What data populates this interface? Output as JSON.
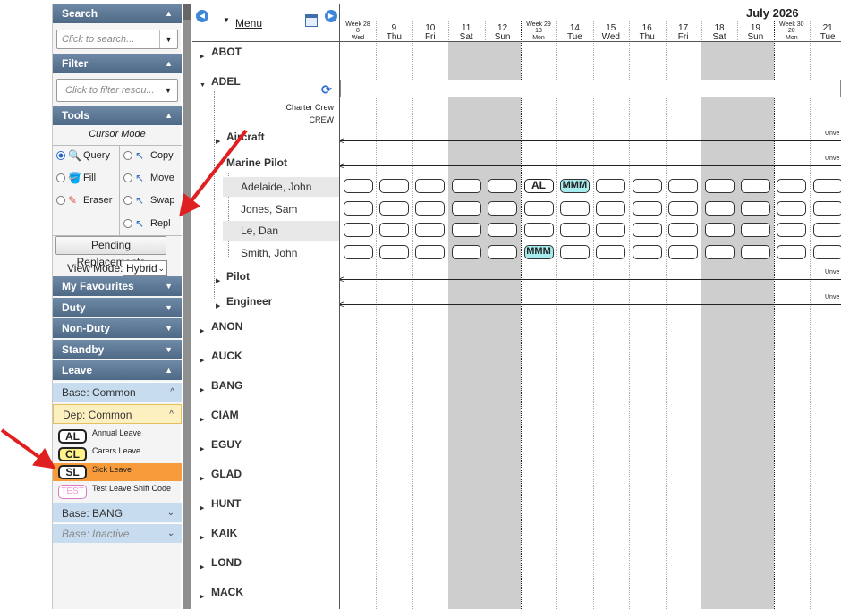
{
  "search": {
    "header": "Search",
    "placeholder": "Click to search..."
  },
  "filter": {
    "header": "Filter",
    "placeholder": "Click to filter resou..."
  },
  "tools": {
    "header": "Tools",
    "cursor_mode_label": "Cursor Mode",
    "items": [
      {
        "label": "Query",
        "selected": true,
        "icon": "magnifier-icon"
      },
      {
        "label": "Copy",
        "selected": false,
        "icon": "copy-cursor-icon"
      },
      {
        "label": "Fill",
        "selected": false,
        "icon": "fill-icon"
      },
      {
        "label": "Move",
        "selected": false,
        "icon": "move-cursor-icon"
      },
      {
        "label": "Eraser",
        "selected": false,
        "icon": "eraser-icon"
      },
      {
        "label": "Swap",
        "selected": false,
        "icon": "swap-cursor-icon"
      },
      {
        "label": "Repl",
        "selected": false,
        "icon": "replace-cursor-icon"
      }
    ],
    "pending_button": "Pending Replacements",
    "view_mode_label": "View Mode:",
    "view_mode_value": "Hybrid"
  },
  "sections": {
    "favourites": "My Favourites",
    "duty": "Duty",
    "non_duty": "Non-Duty",
    "standby": "Standby",
    "leave": "Leave"
  },
  "leave_groups": {
    "base_common": "Base: Common",
    "dep_common": "Dep: Common",
    "base_bang": "Base: BANG",
    "base_inactive": "Base: Inactive"
  },
  "leave_codes": [
    {
      "code": "AL",
      "label": "Annual Leave"
    },
    {
      "code": "CL",
      "label": "Carers Leave"
    },
    {
      "code": "SL",
      "label": "Sick Leave",
      "selected": true
    },
    {
      "code": "TEST",
      "label": "Test Leave Shift Code"
    }
  ],
  "scheduler": {
    "menu_label": "Menu",
    "month_title": "July 2026",
    "days": [
      {
        "week": "Week 28",
        "num": "8",
        "dow": "Wed"
      },
      {
        "num": "9",
        "dow": "Thu"
      },
      {
        "num": "10",
        "dow": "Fri"
      },
      {
        "num": "11",
        "dow": "Sat"
      },
      {
        "num": "12",
        "dow": "Sun"
      },
      {
        "week": "Week 29",
        "num": "13",
        "dow": "Mon"
      },
      {
        "num": "14",
        "dow": "Tue"
      },
      {
        "num": "15",
        "dow": "Wed"
      },
      {
        "num": "16",
        "dow": "Thu"
      },
      {
        "num": "17",
        "dow": "Fri"
      },
      {
        "num": "18",
        "dow": "Sat"
      },
      {
        "num": "19",
        "dow": "Sun"
      },
      {
        "week": "Week 30",
        "num": "20",
        "dow": "Mon"
      },
      {
        "num": "21",
        "dow": "Tue"
      }
    ],
    "groups_top": [
      "ABOT",
      "ADEL"
    ],
    "adel_meta": {
      "crew_type": "Charter Crew",
      "crew_label": "CREW"
    },
    "subgroups": [
      "Aircraft",
      "Marine Pilot",
      "Pilot",
      "Engineer"
    ],
    "people": [
      "Adelaide, John",
      "Jones, Sam",
      "Le, Dan",
      "Smith, John"
    ],
    "groups_bottom": [
      "ANON",
      "AUCK",
      "BANG",
      "CIAM",
      "EGUY",
      "GLAD",
      "HUNT",
      "KAIK",
      "LOND",
      "MACK"
    ],
    "unavailable_text": "Unve",
    "shift_codes": {
      "al": "AL",
      "mmm": "MMM"
    }
  }
}
